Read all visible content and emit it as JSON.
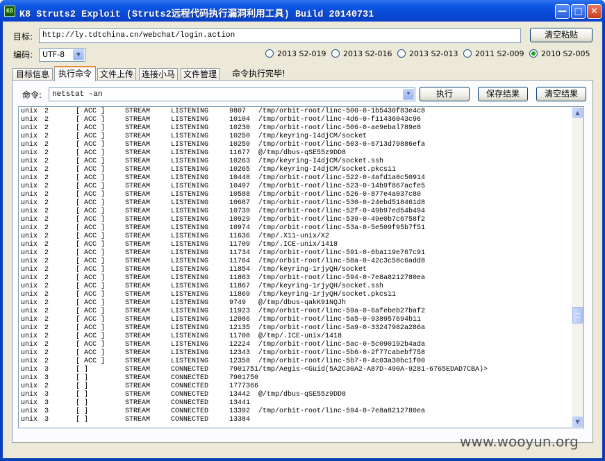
{
  "window": {
    "title": "K8 Struts2 Exploit (Struts2远程代码执行漏洞利用工具) Build 20140731",
    "icon": "K8"
  },
  "target": {
    "label": "目标:",
    "url": "http://ly.tdtchina.cn/webchat/login.action",
    "clear_paste_label": "清空粘贴"
  },
  "encoding": {
    "label": "编码:",
    "value": "UTF-8"
  },
  "exploits": [
    {
      "label": "2013 S2-019",
      "checked": false
    },
    {
      "label": "2013 S2-016",
      "checked": false
    },
    {
      "label": "2013 S2-013",
      "checked": false
    },
    {
      "label": "2011 S2-009",
      "checked": false
    },
    {
      "label": "2010 S2-005",
      "checked": true
    }
  ],
  "tabs": [
    "目标信息",
    "执行命令",
    "文件上传",
    "连接小马",
    "文件管理"
  ],
  "active_tab": "执行命令",
  "status": "命令执行完毕!",
  "command": {
    "label": "命令:",
    "value": "netstat -an",
    "execute_label": "执行",
    "save_label": "保存结果",
    "clear_label": "清空结果"
  },
  "output_lines": [
    [
      "unix",
      "2",
      "[ ACC ]",
      "STREAM",
      "LISTENING",
      "9807",
      "/tmp/orbit-root/linc-500-0-1b5430f83e4c8"
    ],
    [
      "unix",
      "2",
      "[ ACC ]",
      "STREAM",
      "LISTENING",
      "10104",
      "/tmp/orbit-root/linc-4d6-0-f11436043c96"
    ],
    [
      "unix",
      "2",
      "[ ACC ]",
      "STREAM",
      "LISTENING",
      "10230",
      "/tmp/orbit-root/linc-506-0-ae9ebal789e8"
    ],
    [
      "unix",
      "2",
      "[ ACC ]",
      "STREAM",
      "LISTENING",
      "10250",
      "/tmp/keyring-I4djCM/socket"
    ],
    [
      "unix",
      "2",
      "[ ACC ]",
      "STREAM",
      "LISTENING",
      "10259",
      "/tmp/orbit-root/linc-503-0-6713d79886efa"
    ],
    [
      "unix",
      "2",
      "[ ACC ]",
      "STREAM",
      "LISTENING",
      "11677",
      "@/tmp/dbus-qSE55z9DD8"
    ],
    [
      "unix",
      "2",
      "[ ACC ]",
      "STREAM",
      "LISTENING",
      "10263",
      "/tmp/keyring-I4djCM/socket.ssh"
    ],
    [
      "unix",
      "2",
      "[ ACC ]",
      "STREAM",
      "LISTENING",
      "10265",
      "/tmp/keyring-I4djCM/socket.pkcs11"
    ],
    [
      "unix",
      "2",
      "[ ACC ]",
      "STREAM",
      "LISTENING",
      "10448",
      "/tmp/orbit-root/linc-522-0-4afd1a0c50914"
    ],
    [
      "unix",
      "2",
      "[ ACC ]",
      "STREAM",
      "LISTENING",
      "10497",
      "/tmp/orbit-root/linc-523-0-14b9f867acfe5"
    ],
    [
      "unix",
      "2",
      "[ ACC ]",
      "STREAM",
      "LISTENING",
      "10588",
      "/tmp/orbit-root/linc-526-0-877e4a037c80"
    ],
    [
      "unix",
      "2",
      "[ ACC ]",
      "STREAM",
      "LISTENING",
      "10687",
      "/tmp/orbit-root/linc-530-0-24ebd518461d8"
    ],
    [
      "unix",
      "2",
      "[ ACC ]",
      "STREAM",
      "LISTENING",
      "10739",
      "/tmp/orbit-root/linc-52f-0-49b97ed54b494"
    ],
    [
      "unix",
      "2",
      "[ ACC ]",
      "STREAM",
      "LISTENING",
      "10929",
      "/tmp/orbit-root/linc-539-0-49e0b7c6758f2"
    ],
    [
      "unix",
      "2",
      "[ ACC ]",
      "STREAM",
      "LISTENING",
      "10974",
      "/tmp/orbit-root/linc-53a-0-5e509f95b7f51"
    ],
    [
      "unix",
      "2",
      "[ ACC ]",
      "STREAM",
      "LISTENING",
      "11636",
      "/tmp/.X11-unix/X2"
    ],
    [
      "unix",
      "2",
      "[ ACC ]",
      "STREAM",
      "LISTENING",
      "11709",
      "/tmp/.ICE-unix/1418"
    ],
    [
      "unix",
      "2",
      "[ ACC ]",
      "STREAM",
      "LISTENING",
      "11734",
      "/tmp/orbit-root/linc-591-0-6ba119e767c91"
    ],
    [
      "unix",
      "2",
      "[ ACC ]",
      "STREAM",
      "LISTENING",
      "11764",
      "/tmp/orbit-root/linc-58a-0-42c3c58c6add8"
    ],
    [
      "unix",
      "2",
      "[ ACC ]",
      "STREAM",
      "LISTENING",
      "11854",
      "/tmp/keyring-1rjyQH/socket"
    ],
    [
      "unix",
      "2",
      "[ ACC ]",
      "STREAM",
      "LISTENING",
      "11863",
      "/tmp/orbit-root/linc-594-0-7e8a8212780ea"
    ],
    [
      "unix",
      "2",
      "[ ACC ]",
      "STREAM",
      "LISTENING",
      "11867",
      "/tmp/keyring-1rjyQH/socket.ssh"
    ],
    [
      "unix",
      "2",
      "[ ACC ]",
      "STREAM",
      "LISTENING",
      "11869",
      "/tmp/keyring-1rjyQH/socket.pkcs11"
    ],
    [
      "unix",
      "2",
      "[ ACC ]",
      "STREAM",
      "LISTENING",
      "9749",
      "@/tmp/dbus-qakK91NQJh"
    ],
    [
      "unix",
      "2",
      "[ ACC ]",
      "STREAM",
      "LISTENING",
      "11923",
      "/tmp/orbit-root/linc-59a-0-6afebeb27baf2"
    ],
    [
      "unix",
      "2",
      "[ ACC ]",
      "STREAM",
      "LISTENING",
      "12086",
      "/tmp/orbit-root/linc-5a5-0-938957694b11"
    ],
    [
      "unix",
      "2",
      "[ ACC ]",
      "STREAM",
      "LISTENING",
      "12135",
      "/tmp/orbit-root/linc-5a9-0-33247982a286a"
    ],
    [
      "unix",
      "2",
      "[ ACC ]",
      "STREAM",
      "LISTENING",
      "11708",
      "@/tmp/.ICE-unix/1418"
    ],
    [
      "unix",
      "2",
      "[ ACC ]",
      "STREAM",
      "LISTENING",
      "12224",
      "/tmp/orbit-root/linc-5ac-0-5c090192b4ada"
    ],
    [
      "unix",
      "2",
      "[ ACC ]",
      "STREAM",
      "LISTENING",
      "12343",
      "/tmp/orbit-root/linc-5b6-0-2f77cabebf758"
    ],
    [
      "unix",
      "2",
      "[ ACC ]",
      "STREAM",
      "LISTENING",
      "12358",
      "/tmp/orbit-root/linc-5b7-0-4c03a30bc1f00"
    ],
    [
      "unix",
      "3",
      "[ ]",
      "STREAM",
      "CONNECTED",
      "7901751",
      "/tmp/Aegis-<Guid(5A2C30A2-A87D-490A-9281-6765EDAD7CBA)>"
    ],
    [
      "unix",
      "3",
      "[ ]",
      "STREAM",
      "CONNECTED",
      "7901750",
      ""
    ],
    [
      "unix",
      "2",
      "[ ]",
      "STREAM",
      "CONNECTED",
      "1777366",
      ""
    ],
    [
      "unix",
      "3",
      "[ ]",
      "STREAM",
      "CONNECTED",
      "13442",
      "@/tmp/dbus-qSE55z9DD8"
    ],
    [
      "unix",
      "3",
      "[ ]",
      "STREAM",
      "CONNECTED",
      "13441",
      ""
    ],
    [
      "unix",
      "3",
      "[ ]",
      "STREAM",
      "CONNECTED",
      "13392",
      "/tmp/orbit-root/linc-594-0-7e8a8212780ea"
    ],
    [
      "unix",
      "3",
      "[ ]",
      "STREAM",
      "CONNECTED",
      "13384",
      ""
    ]
  ],
  "watermark": "www.wooyun.org"
}
